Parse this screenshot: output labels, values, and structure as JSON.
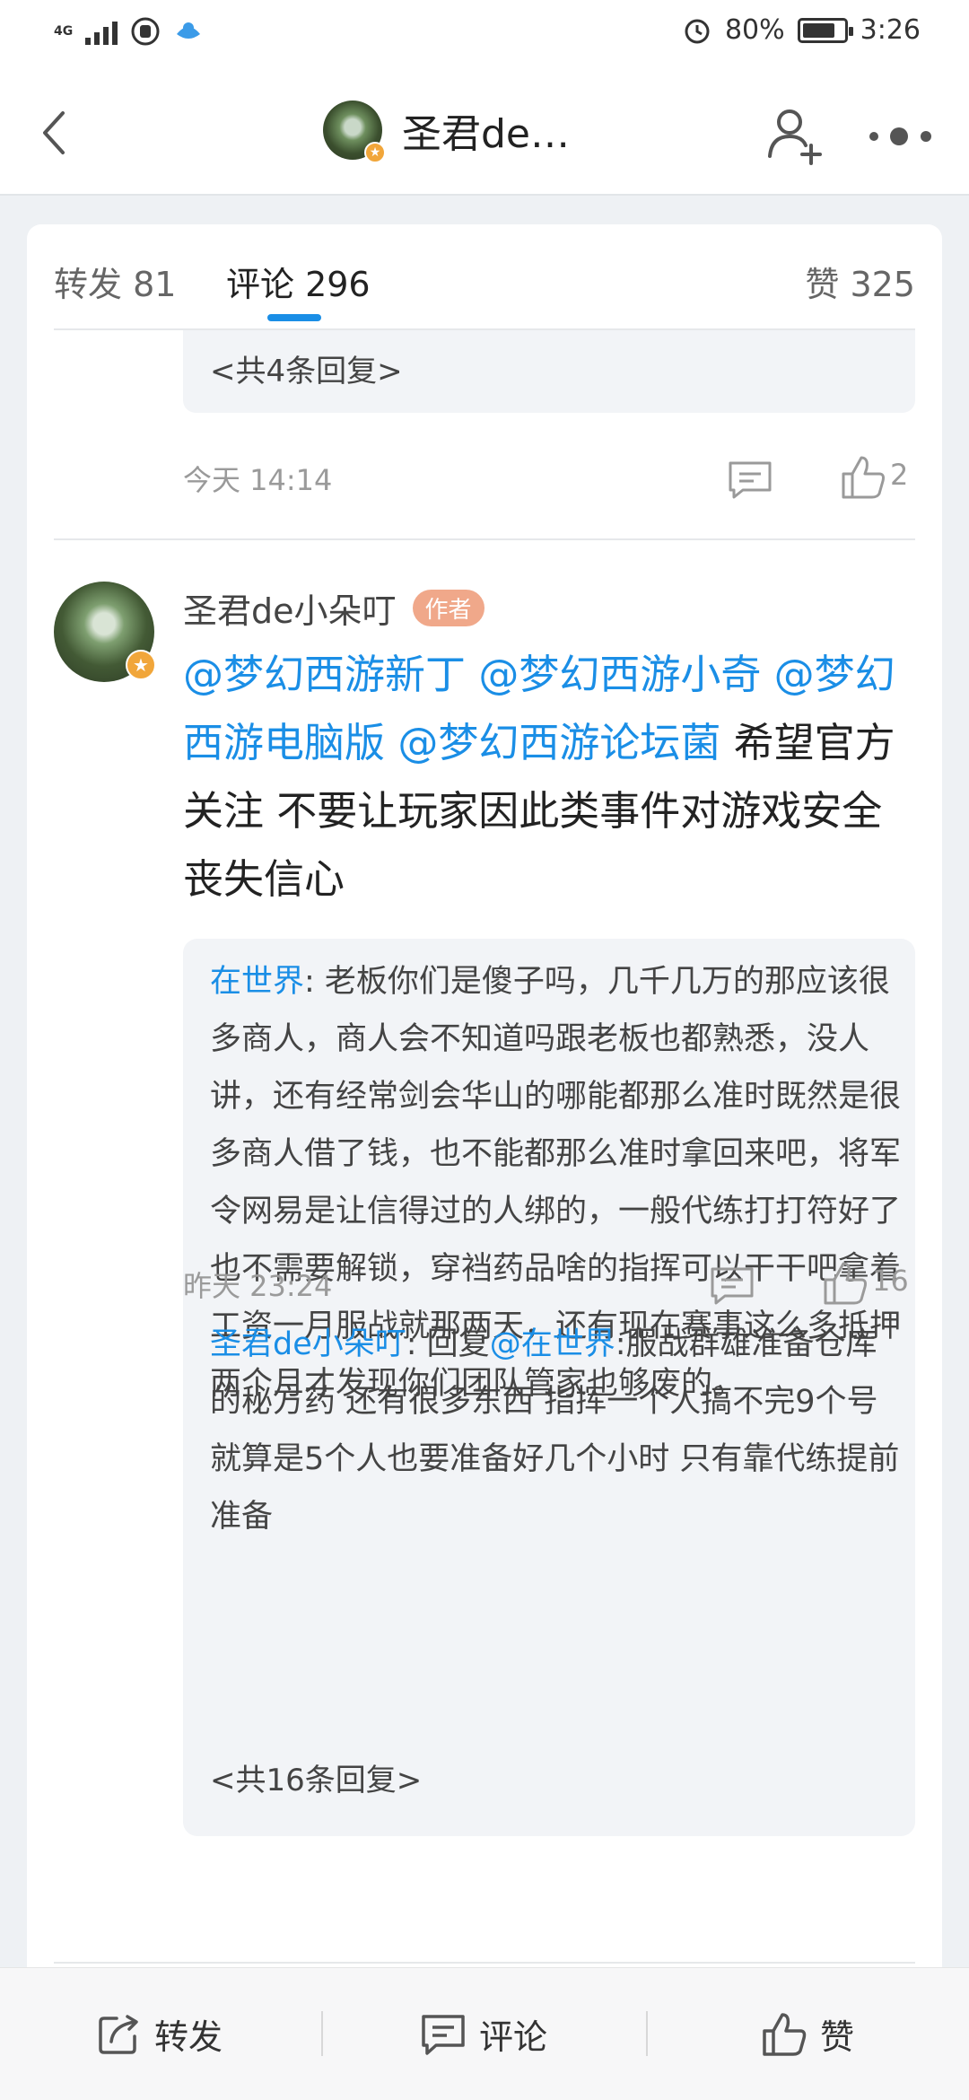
{
  "status_bar": {
    "network": "4G",
    "battery_percent": "80%",
    "battery_level": 0.8,
    "time": "3:26",
    "icons": [
      "signal-icon",
      "hand-icon",
      "app-notification-icon",
      "alarm-icon",
      "battery-icon"
    ]
  },
  "header": {
    "title": "圣君de…",
    "icons": [
      "back-icon",
      "avatar",
      "follow-icon",
      "more-icon"
    ]
  },
  "tabs": [
    {
      "label": "转发 81"
    },
    {
      "label": "评论 296"
    },
    {
      "label": "赞 325"
    }
  ],
  "prev_comment": {
    "reply_count_text": "<共4条回复>",
    "time": "今天 14:14",
    "likes": "2"
  },
  "comment": {
    "author": "圣君de小朵叮",
    "author_tag": "作者",
    "mentions": [
      "@梦幻西游新丁",
      "@梦幻西游小奇",
      "@梦",
      "幻西游电脑版",
      "@梦幻西游论坛菌"
    ],
    "text": "希望官方关注 不要让玩家因此类事件对游戏安全丧失信心",
    "replies": [
      {
        "author": "在世界",
        "text": ": 老板你们是傻子吗，几千几万的那应该很多商人，商人会不知道吗跟老板也都熟悉，没人讲，还有经常剑会华山的哪能都那么准时既然是很多商人借了钱，也不能都那么准时拿回来吧，将军令网易是让信得过的人绑的，一般代练打打符好了也不需要解锁，穿裆药品啥的指挥可以干干吧拿着工资一月服战就那两天，还有现在赛事这么多抵押两个月才发现你们团队管家也够废的。"
      },
      {
        "author": "圣君de小朵叮",
        "prefix": ": 回复",
        "mention": "@在世界",
        "text": ":服战群雄准备仓库的秘方药 还有很多东西 指挥一个人搞不完9个号 就算是5个人也要准备好几个小时 只有靠代练提前准备"
      }
    ],
    "reply_count_text": "<共16条回复>",
    "time": "昨天 23:24",
    "likes": "16"
  },
  "bottom_bar": {
    "repost_label": "转发",
    "comment_label": "评论",
    "like_label": "赞"
  },
  "colors": {
    "accent": "#1a8ee6",
    "author_tag": "#f0a88a",
    "reply_bg": "#f2f4f7",
    "page_bg": "#eef1f4"
  }
}
